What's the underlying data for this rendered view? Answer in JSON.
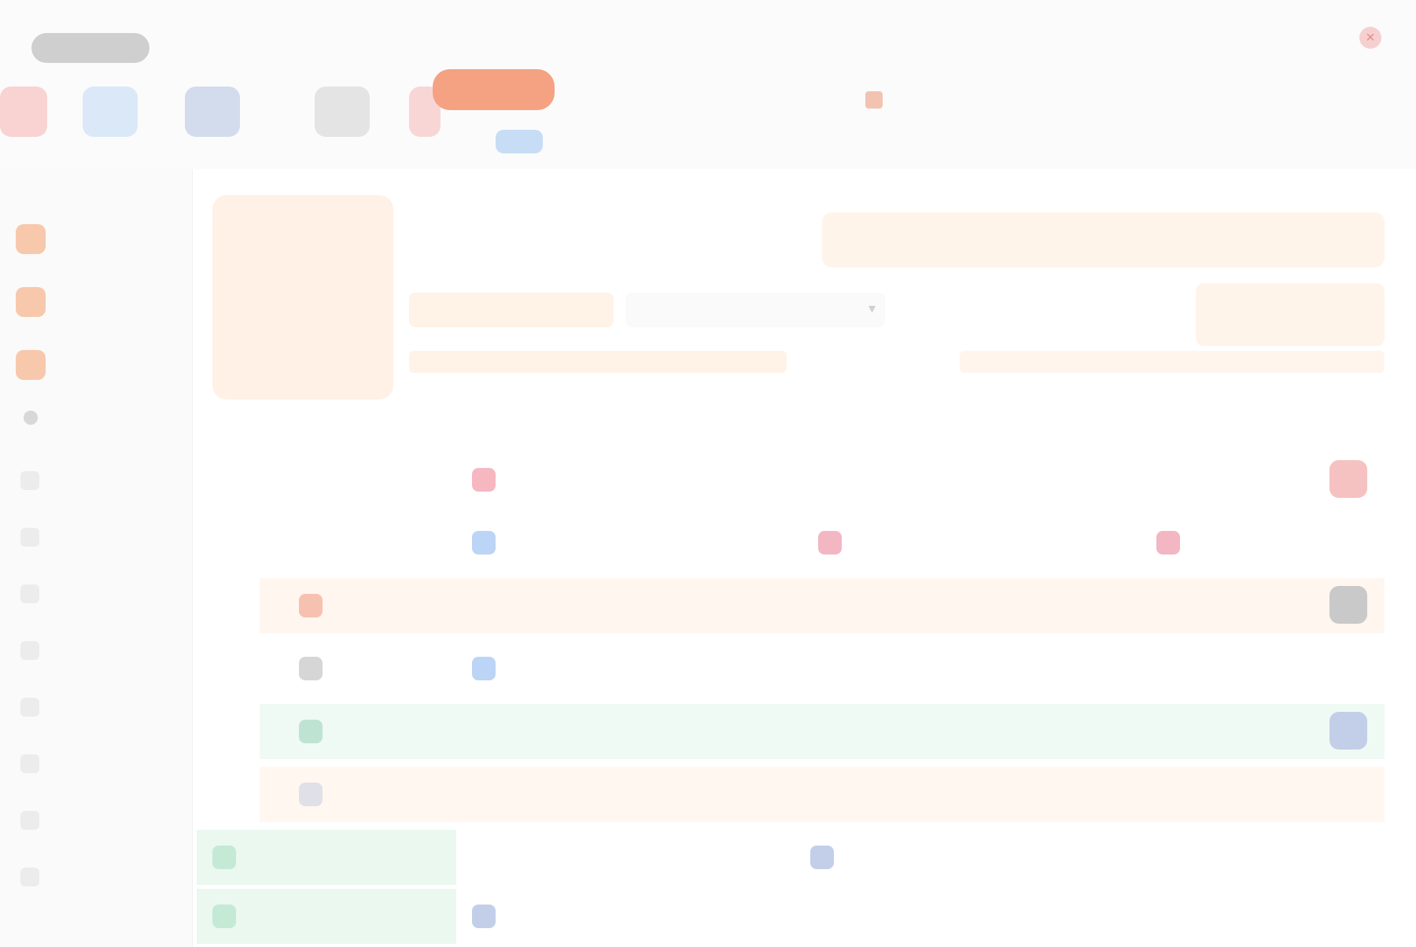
{
  "topbar": {
    "logo_label": "",
    "link_label": "",
    "corner_label": "",
    "close_icon": "close-icon"
  },
  "nav": {
    "active_tab": "",
    "secondary_tab": "",
    "breadcrumb": "",
    "buttons": [
      {
        "color": "#f6b6b6"
      },
      {
        "color": "#bdd6f5"
      },
      {
        "color": "#9fb4d9"
      },
      {
        "color": "#c9c9c9"
      },
      {
        "color": "#f6b6b6"
      }
    ]
  },
  "sidebar": {
    "items": [
      {
        "label": ""
      },
      {
        "label": ""
      },
      {
        "label": ""
      }
    ],
    "section_title": "",
    "rows": [
      {
        "label": ""
      },
      {
        "label": ""
      },
      {
        "label": ""
      },
      {
        "label": ""
      },
      {
        "label": ""
      },
      {
        "label": ""
      },
      {
        "label": ""
      },
      {
        "label": ""
      }
    ]
  },
  "hero": {
    "title": "",
    "value": ""
  },
  "header": {
    "title": "",
    "banner_text": ""
  },
  "fields": {
    "a_value": "",
    "b_value": "",
    "c_value": "",
    "strip_b": ""
  },
  "table": {
    "headers": [
      "",
      "",
      "",
      "",
      "",
      ""
    ],
    "rows": [
      {
        "cells": [
          {
            "label": "",
            "icon_color": "#f6b7c1"
          }
        ],
        "end_color": "#f6c1c1"
      },
      {
        "cells": [
          {
            "label": "",
            "icon_color": "#bcd4f5"
          },
          {
            "label": "",
            "icon_color": "#f3b6c3"
          },
          {
            "label": "",
            "icon_color": "#f3b6c3"
          }
        ]
      },
      {
        "cells": [
          {
            "label": "",
            "icon_color": "#f7c1b1"
          }
        ],
        "end_color": "#c9c9c9"
      },
      {
        "cells": [
          {
            "label": "",
            "icon_color": "#d6d6d6"
          },
          {
            "label": "",
            "icon_color": "#bcd4f5"
          }
        ]
      },
      {
        "cells": [
          {
            "label": "",
            "icon_color": "#bfe3d3"
          }
        ],
        "end_color": "#c3cfe9"
      },
      {
        "cells": [
          {
            "label": "",
            "icon_color": "#e0e0e8"
          }
        ]
      },
      {
        "cells": [
          {
            "label": "",
            "icon_color": "#c4e9d5"
          },
          {
            "label": "",
            "icon_color": "#c3cfe9"
          }
        ]
      },
      {
        "cells": [
          {
            "label": "",
            "icon_color": "#c4e9d5"
          },
          {
            "label": "",
            "icon_color": "#c3cfe9"
          }
        ]
      }
    ]
  }
}
